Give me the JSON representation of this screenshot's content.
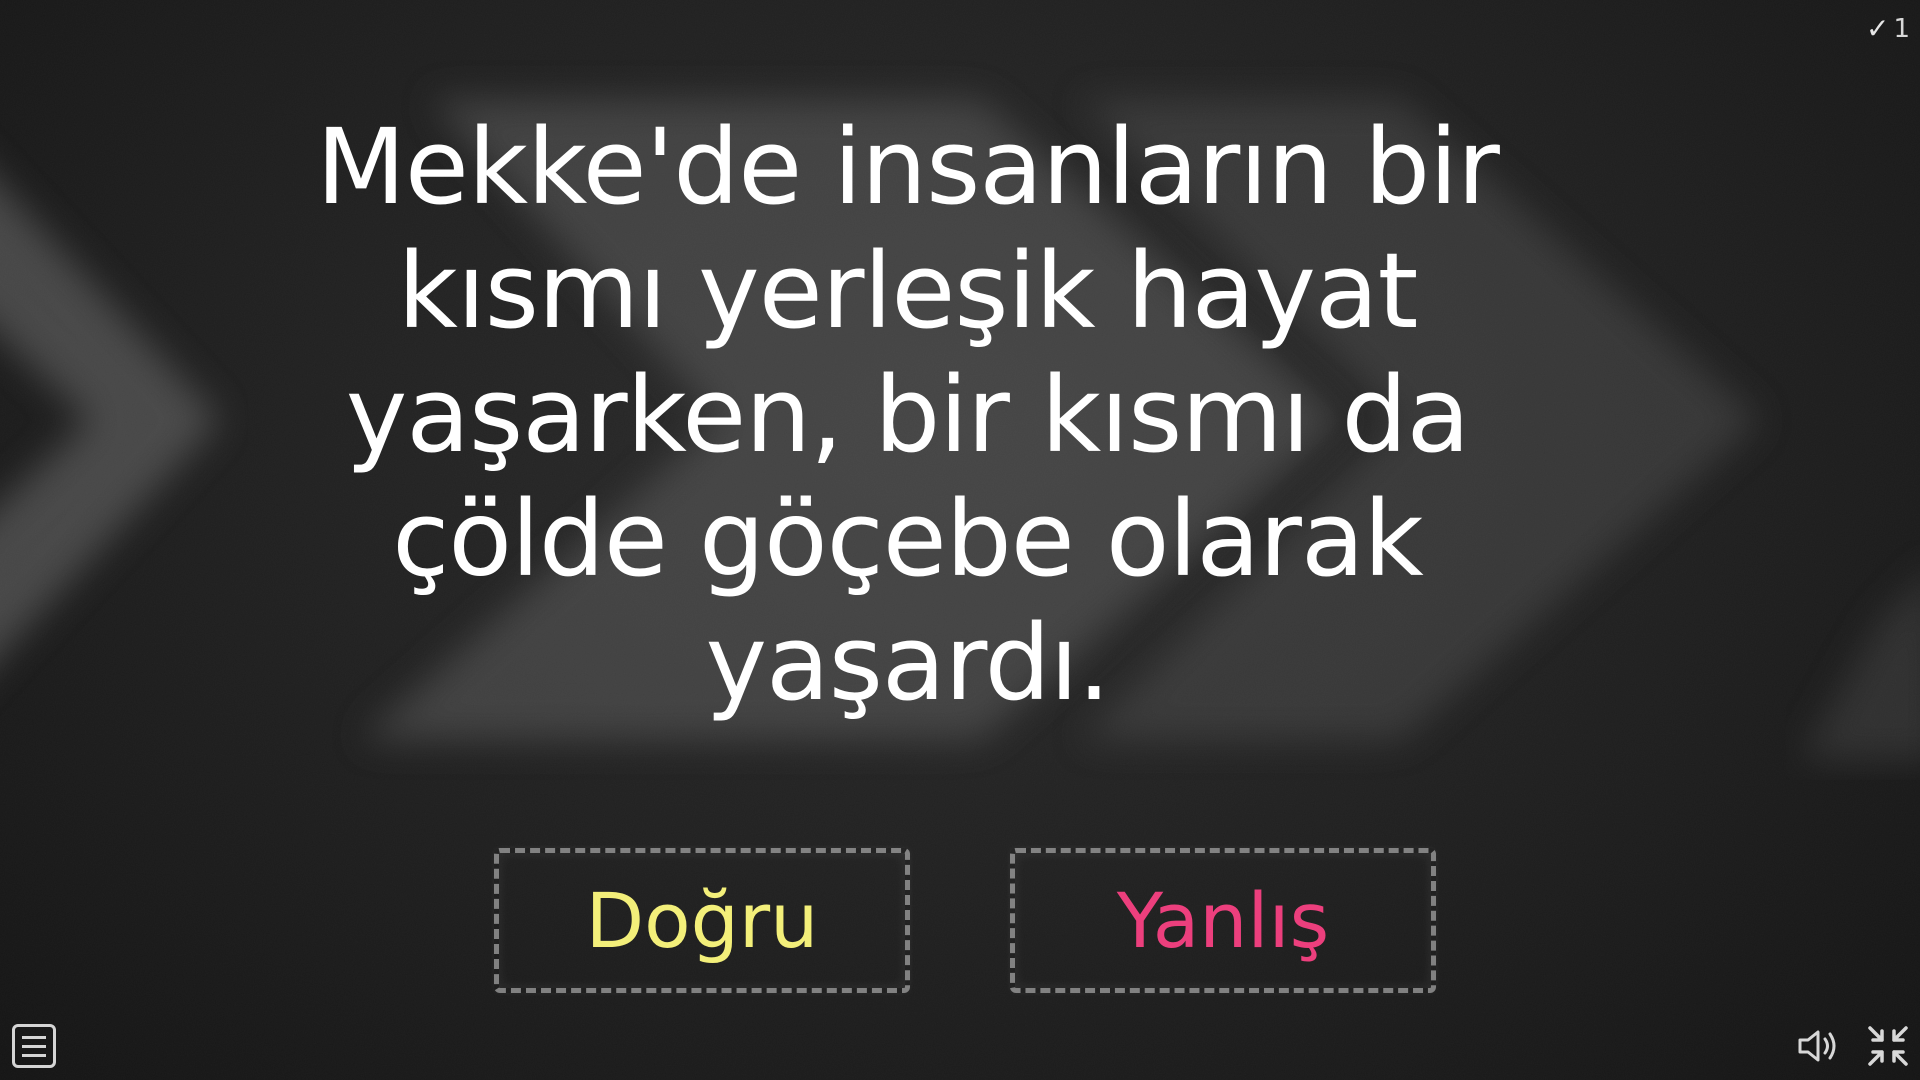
{
  "score": {
    "icon": "check-icon",
    "value": "1"
  },
  "question": {
    "text": "Mekke'de insanların bir kısmı yerleşik hayat yaşarken, bir kısmı da çölde göçebe olarak yaşardı."
  },
  "answers": {
    "true_label": "Doğru",
    "false_label": "Yanlış",
    "true_color": "#f3ef7a",
    "false_color": "#ec3f7d"
  },
  "controls": {
    "menu_icon": "menu-icon",
    "sound_icon": "speaker-icon",
    "fullscreen_icon": "exit-fullscreen-icon"
  }
}
